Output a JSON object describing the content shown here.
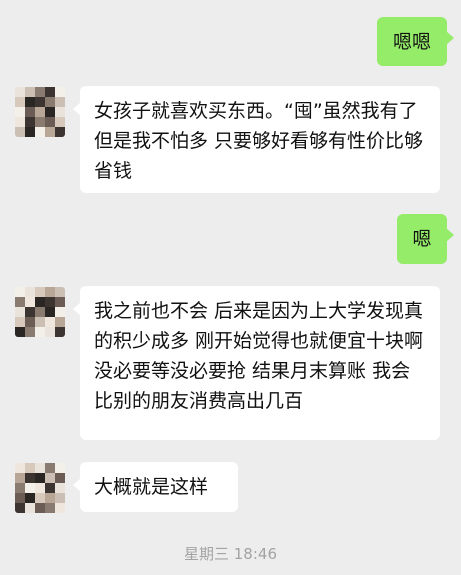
{
  "messages": [
    {
      "side": "out",
      "text": "嗯嗯"
    },
    {
      "side": "in",
      "text": "女孩子就喜欢买东西。“囤”虽然我有了 但是我不怕多 只要够好看够有性价比够省钱"
    },
    {
      "side": "out",
      "text": "嗯"
    },
    {
      "side": "in",
      "text": "我之前也不会 后来是因为上大学发现真的积少成多 刚开始觉得也就便宜十块啊没必要等没必要抢 结果月末算账 我会比别的朋友消费高出几百"
    },
    {
      "side": "in",
      "text": "大概就是这样"
    }
  ],
  "timestamp": "星期三 18:46",
  "colors": {
    "background": "#ededed",
    "incoming_bubble": "#ffffff",
    "outgoing_bubble": "#95ec69"
  },
  "avatar_icon": "pixelated-avatar-icon"
}
